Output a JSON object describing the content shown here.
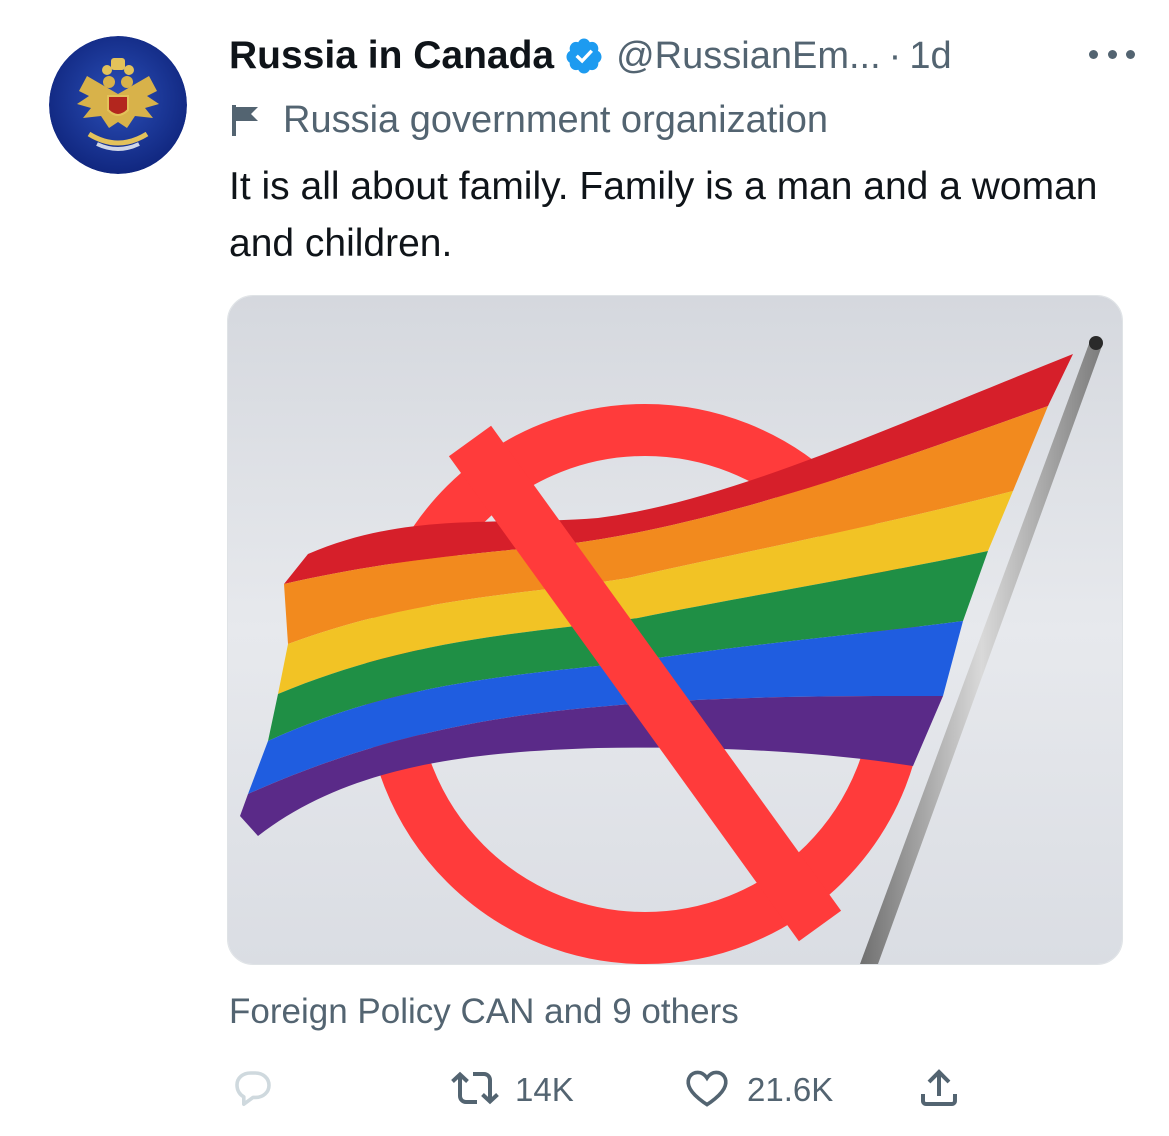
{
  "tweet": {
    "author": {
      "display_name": "Russia in Canada",
      "handle": "@RussianEm...",
      "separator": "·",
      "time": "1d",
      "label": "Russia government organization",
      "avatar_icon": "coat-of-arms-icon",
      "verified_icon": "verified-badge-icon"
    },
    "text": "It is all about family. Family is a man and a woman and children.",
    "media": {
      "description_icon": "prohibited-rainbow-flag-image"
    },
    "liked_by": "Foreign Policy CAN and 9 others",
    "actions": {
      "reply_count": "",
      "retweet_count": "14K",
      "like_count": "21.6K"
    }
  },
  "colors": {
    "accent_blue": "#1d9bf0",
    "text_primary": "#0f1419",
    "text_secondary": "#536471",
    "prohibition_red": "#ff3b3b"
  }
}
